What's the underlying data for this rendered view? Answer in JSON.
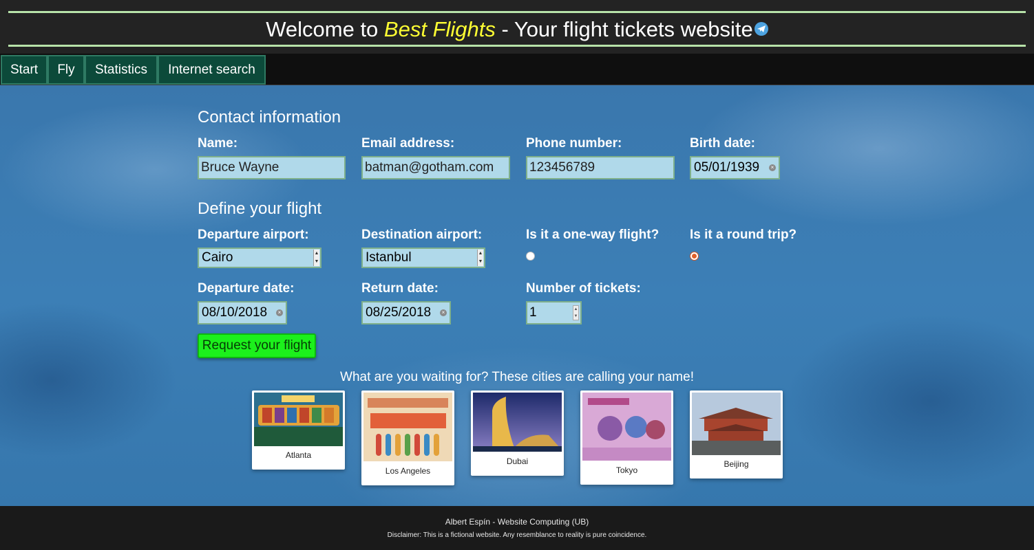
{
  "header": {
    "title_prefix": "Welcome to ",
    "brand": "Best Flights",
    "title_suffix": " - Your flight tickets website",
    "icon": "telegram-plane-icon"
  },
  "nav": {
    "tabs": [
      {
        "label": "Start"
      },
      {
        "label": "Fly"
      },
      {
        "label": "Statistics"
      },
      {
        "label": "Internet search"
      }
    ]
  },
  "contact": {
    "title": "Contact information",
    "name_label": "Name:",
    "name_value": "Bruce Wayne",
    "email_label": "Email address:",
    "email_value": "batman@gotham.com",
    "phone_label": "Phone number:",
    "phone_value": "123456789",
    "birth_label": "Birth date:",
    "birth_value": "05/01/1939"
  },
  "flight": {
    "title": "Define your flight",
    "departure_label": "Departure airport:",
    "departure_value": "Cairo",
    "destination_label": "Destination airport:",
    "destination_value": "Istanbul",
    "oneway_label": "Is it a one-way flight?",
    "oneway_checked": false,
    "roundtrip_label": "Is it a round trip?",
    "roundtrip_checked": true,
    "departure_date_label": "Departure date:",
    "departure_date_value": "08/10/2018",
    "return_date_label": "Return date:",
    "return_date_value": "08/25/2018",
    "tickets_label": "Number of tickets:",
    "tickets_value": "1",
    "submit_label": "Request your flight"
  },
  "promo": {
    "text": "What are you waiting for? These cities are calling your name!",
    "cities": [
      {
        "name": "Atlanta"
      },
      {
        "name": "Los Angeles"
      },
      {
        "name": "Dubai"
      },
      {
        "name": "Tokyo"
      },
      {
        "name": "Beijing"
      }
    ]
  },
  "footer": {
    "credit": "Albert Espín - Website Computing (UB)",
    "disclaimer": "Disclaimer: This is a fictional website. Any resemblance to reality is pure coincidence."
  },
  "colors": {
    "accent_yellow": "#ffff33",
    "nav_green": "#0c4a3a",
    "button_green": "#1cf01c",
    "field_blue": "#b0d9ea"
  }
}
